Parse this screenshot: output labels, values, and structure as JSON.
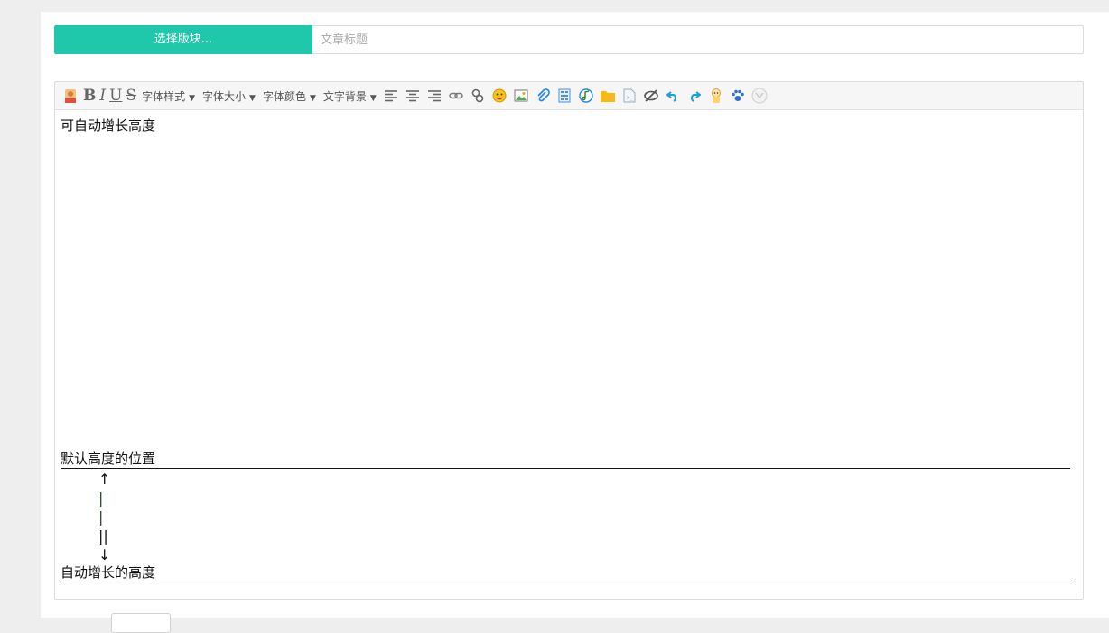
{
  "post_form": {
    "board_select_label": "选择版块...",
    "title_placeholder": "文章标题"
  },
  "editor": {
    "toolbar": {
      "bold": "B",
      "italic": "I",
      "underline": "U",
      "strike": "S",
      "font_style": "字体样式",
      "font_size": "字体大小",
      "font_color": "字体颜色",
      "text_background": "文字背景",
      "dropdown_arrow": "▼",
      "icons": [
        "html-icon",
        "bold-icon",
        "italic-icon",
        "underline-icon",
        "strikethrough-icon",
        "align-left-icon",
        "align-center-icon",
        "align-right-icon",
        "link-icon",
        "unlink-icon",
        "emoji-icon",
        "image-icon",
        "attachment-icon",
        "video-icon",
        "music-icon",
        "folder-icon",
        "code-icon",
        "hide-icon",
        "undo-icon",
        "redo-icon",
        "baby-icon",
        "paw-icon",
        "toggle-icon"
      ]
    },
    "content": {
      "first_line": "可自动增长高度",
      "default_height_label": "默认高度的位置",
      "arrow_up": "↑",
      "bar_1": "|",
      "bar_2": "|",
      "bar_3": "||",
      "arrow_down": "↓",
      "auto_height_label": "自动增长的高度"
    }
  },
  "colors": {
    "accent": "#1fc8aa",
    "toolbar_bg": "#f6f6f6",
    "page_bg": "#eeeeee"
  }
}
